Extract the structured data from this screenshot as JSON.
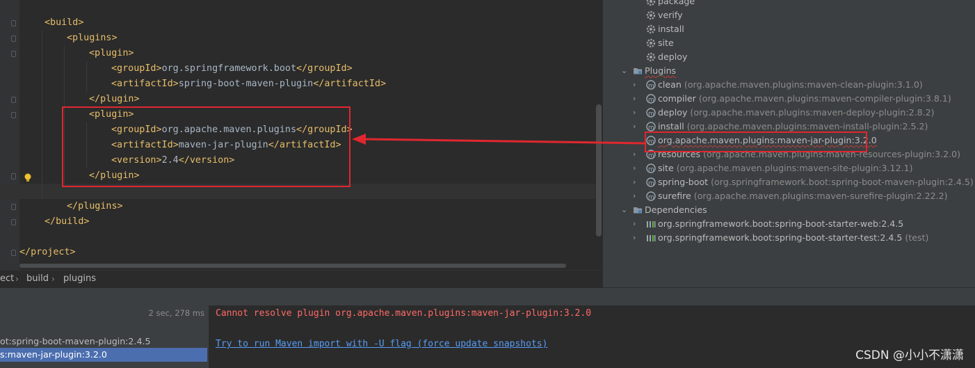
{
  "editor": {
    "lines": [
      {
        "indent": 1,
        "parts": [
          {
            "t": "tag",
            "v": "<build>"
          }
        ]
      },
      {
        "indent": 2,
        "parts": [
          {
            "t": "tag",
            "v": "<plugins>"
          }
        ]
      },
      {
        "indent": 3,
        "parts": [
          {
            "t": "tag",
            "v": "<plugin>"
          }
        ]
      },
      {
        "indent": 4,
        "parts": [
          {
            "t": "tag",
            "v": "<groupId>"
          },
          {
            "t": "txt",
            "v": "org.springframework.boot"
          },
          {
            "t": "tag",
            "v": "</groupId>"
          }
        ]
      },
      {
        "indent": 4,
        "parts": [
          {
            "t": "tag",
            "v": "<artifactId>"
          },
          {
            "t": "txt",
            "v": "spring-boot-maven-plugin"
          },
          {
            "t": "tag",
            "v": "</artifactId>"
          }
        ]
      },
      {
        "indent": 3,
        "parts": [
          {
            "t": "tag",
            "v": "</plugin>"
          }
        ]
      },
      {
        "indent": 3,
        "parts": [
          {
            "t": "tag",
            "v": "<plugin>"
          }
        ]
      },
      {
        "indent": 4,
        "parts": [
          {
            "t": "tag",
            "v": "<groupId>"
          },
          {
            "t": "txt",
            "v": "org.apache.maven.plugins"
          },
          {
            "t": "tag",
            "v": "</groupId>"
          }
        ]
      },
      {
        "indent": 4,
        "parts": [
          {
            "t": "tag",
            "v": "<artifactId>"
          },
          {
            "t": "txt",
            "v": "maven-jar-plugin"
          },
          {
            "t": "tag",
            "v": "</artifactId>"
          }
        ]
      },
      {
        "indent": 4,
        "parts": [
          {
            "t": "tag",
            "v": "<version>"
          },
          {
            "t": "txt",
            "v": "2.4"
          },
          {
            "t": "tag",
            "v": "</version>"
          }
        ]
      },
      {
        "indent": 3,
        "parts": [
          {
            "t": "tag",
            "v": "</plugin>"
          }
        ]
      },
      {
        "indent": 0,
        "parts": []
      },
      {
        "indent": 2,
        "parts": [
          {
            "t": "tag",
            "v": "</plugins>"
          }
        ]
      },
      {
        "indent": 1,
        "parts": [
          {
            "t": "tag",
            "v": "</build>"
          }
        ]
      },
      {
        "indent": 0,
        "parts": []
      },
      {
        "indent": 0,
        "parts": [
          {
            "t": "tag",
            "v": "</project>"
          }
        ]
      }
    ]
  },
  "breadcrumb": {
    "items": [
      "ect",
      "build",
      "plugins"
    ]
  },
  "maven_tree": {
    "lifecycle": [
      "package",
      "verify",
      "install",
      "site",
      "deploy"
    ],
    "plugins_label": "Plugins",
    "plugins": [
      {
        "name": "clean",
        "hint": "(org.apache.maven.plugins:maven-clean-plugin:3.1.0)",
        "error": false
      },
      {
        "name": "compiler",
        "hint": "(org.apache.maven.plugins:maven-compiler-plugin:3.8.1)",
        "error": false
      },
      {
        "name": "deploy",
        "hint": "(org.apache.maven.plugins:maven-deploy-plugin:2.8.2)",
        "error": false
      },
      {
        "name": "install",
        "hint": "(org.apache.maven.plugins:maven-install-plugin:2.5.2)",
        "error": false
      },
      {
        "name": "org.apache.maven.plugins:maven-jar-plugin:3.2.0",
        "hint": "",
        "error": true
      },
      {
        "name": "resources",
        "hint": "(org.apache.maven.plugins:maven-resources-plugin:3.2.0)",
        "error": false
      },
      {
        "name": "site",
        "hint": "(org.apache.maven.plugins:maven-site-plugin:3.12.1)",
        "error": false
      },
      {
        "name": "spring-boot",
        "hint": "(org.springframework.boot:spring-boot-maven-plugin:2.4.5)",
        "error": false
      },
      {
        "name": "surefire",
        "hint": "(org.apache.maven.plugins:maven-surefire-plugin:2.22.2)",
        "error": false
      }
    ],
    "dependencies_label": "Dependencies",
    "dependencies": [
      {
        "name": "org.springframework.boot:spring-boot-starter-web:2.4.5",
        "hint": ""
      },
      {
        "name": "org.springframework.boot:spring-boot-starter-test:2.4.5",
        "hint": "(test)"
      }
    ]
  },
  "run_panel": {
    "time": "2 sec, 278 ms",
    "rows": [
      {
        "label": "ot:spring-boot-maven-plugin:2.4.5",
        "selected": false
      },
      {
        "label": "s:maven-jar-plugin:3.2.0",
        "selected": true
      }
    ]
  },
  "console": {
    "error": "Cannot resolve plugin org.apache.maven.plugins:maven-jar-plugin:3.2.0",
    "link": "Try to run Maven import with -U flag (force update snapshots)"
  },
  "watermark": "CSDN @小小不潇潇",
  "colors": {
    "tag": "#e8bf6a",
    "text": "#a9b7c6",
    "error": "#ff6b68",
    "link": "#589df6",
    "highlight": "#e0272f",
    "selection": "#4b6eaf"
  }
}
